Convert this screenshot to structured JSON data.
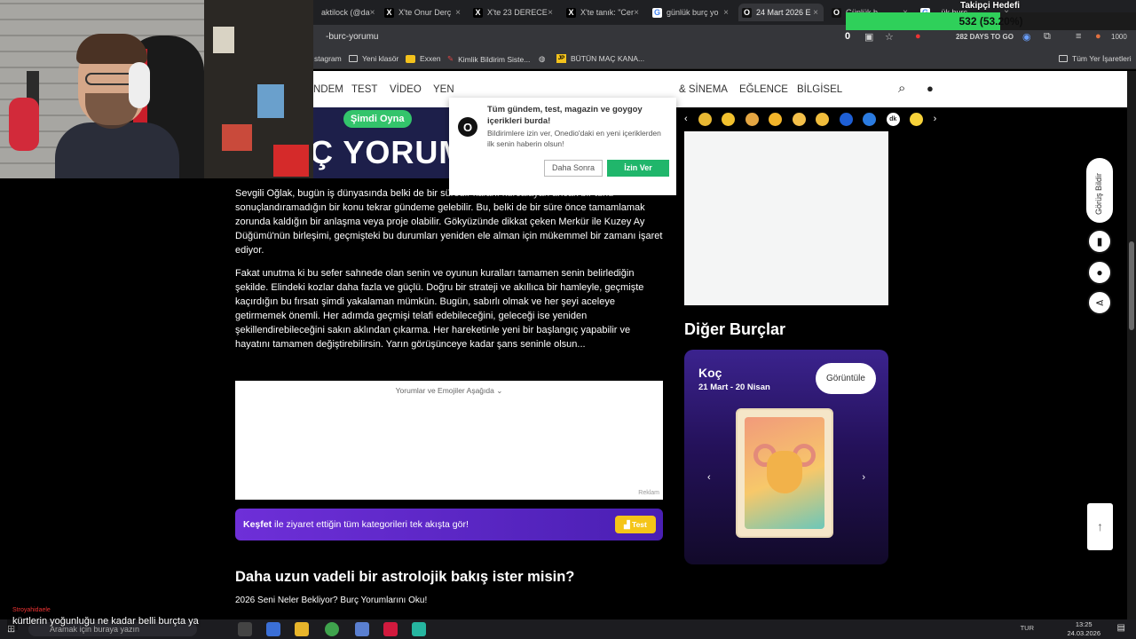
{
  "stream": {
    "follower_goal_title": "Takipçi Hedefi",
    "follower_goal_text": "532 (53.20%)",
    "follower_goal_fraction": 0.532,
    "goal_color": "#2fd05a"
  },
  "browser": {
    "tabs": [
      {
        "title": "aktilock (@da",
        "icon": "bird-icon"
      },
      {
        "title": "X'te Onur Derç",
        "icon": "x-logo-icon"
      },
      {
        "title": "X'te 23 DERECE",
        "icon": "x-logo-icon"
      },
      {
        "title": "X'te tanık: \"Cer",
        "icon": "x-logo-icon"
      },
      {
        "title": "günlük burç yo",
        "icon": "google-icon"
      },
      {
        "title": "24 Mart 2026 E",
        "icon": "onedio-icon"
      },
      {
        "title": "Günlük b",
        "icon": "onedio-icon"
      },
      {
        "title": "...ük burç",
        "icon": "google-icon"
      }
    ],
    "url": "-burc-yorumu",
    "zoom_badge": "0",
    "toolbar_text": "282 DAYS TO GO",
    "toolbar_count": "1000",
    "bookmarks": [
      {
        "label": "stagram",
        "icon": "instagram-icon"
      },
      {
        "label": "Yeni klasör",
        "icon": "folder-icon"
      },
      {
        "label": "Exxen",
        "icon": "exxen-icon"
      },
      {
        "label": "Kimlik Bildirim Siste...",
        "icon": "link-icon"
      },
      {
        "label": "",
        "icon": "globe-icon"
      },
      {
        "label": "BÜTÜN MAÇ KANA...",
        "icon": "jp-icon"
      }
    ],
    "all_bookmarks_label": "Tüm Yer İşaretleri"
  },
  "site": {
    "nav_items": [
      "NDEM",
      "TEST",
      "VİDEO",
      "YEN",
      "& SİNEMA",
      "EĞLENCE",
      "BİLGİSEL"
    ],
    "hero_button": "Şimdi Oyna",
    "hero_text": "Ç YORUMU",
    "emoji_reactions": [
      {
        "icon": "trophy-icon",
        "color": "#e8b833"
      },
      {
        "icon": "infinity-icon",
        "color": "#f2c12e"
      },
      {
        "icon": "neutral-face-icon",
        "color": "#e5a642"
      },
      {
        "icon": "heart-eyes-icon",
        "color": "#f3b52a"
      },
      {
        "icon": "crying-face-icon",
        "color": "#f4c04a"
      },
      {
        "icon": "smile-icon",
        "color": "#f1bd3c"
      },
      {
        "icon": "blue-badge-icon",
        "color": "#1e5fd6"
      },
      {
        "icon": "blue-badge-2-icon",
        "color": "#2b7be0"
      },
      {
        "icon": "dk-badge-icon",
        "color": "#ffffff",
        "text": "dk"
      },
      {
        "icon": "yellow-badge-icon",
        "color": "#f7d23a"
      }
    ]
  },
  "popup": {
    "title": "Tüm gündem, test, magazin ve goygoy içerikleri burda!",
    "body": "Bildirimlere izin ver, Onedio'daki en yeni içeriklerden ilk senin haberin olsun!",
    "later": "Daha Sonra",
    "allow": "İzin Ver",
    "logo": "O"
  },
  "article": {
    "p1": "Sevgili Oğlak, bugün iş dünyasında belki de bir süredir kafanı kurcalayan ancak bir türlü sonuçlandıramadığın bir konu tekrar gündeme gelebilir. Bu, belki de bir süre önce tamamlamak zorunda kaldığın bir anlaşma veya proje olabilir. Gökyüzünde dikkat çeken Merkür ile Kuzey Ay Düğümü'nün birleşimi, geçmişteki bu durumları yeniden ele alman için mükemmel bir zamanı işaret ediyor.",
    "p2": "Fakat unutma ki bu sefer sahnede olan senin ve oyunun kuralları tamamen senin belirlediğin şekilde. Elindeki kozlar daha fazla ve güçlü. Doğru bir strateji ve akıllıca bir hamleyle, geçmişte kaçırdığın bu fırsatı şimdi yakalaman mümkün. Bugün, sabırlı olmak ve her şeyi aceleye getirmemek önemli. Her adımda geçmişi telafi edebileceğini, geleceği ise yeniden şekillendirebileceğini sakın aklından çıkarma. Her hareketinle yeni bir başlangıç yapabilir ve hayatını tamamen değiştirebilirsin. Yarın görüşünceye kadar şans seninle olsun...",
    "comments_header": "Yorumlar ve Emojiler Aşağıda",
    "ad_label": "Reklam",
    "kesfet_bold": "Keşfet",
    "kesfet_rest": " ile ziyaret ettiğin tüm kategorileri tek akışta gör!",
    "kesfet_button": "Test",
    "h2": "Daha uzun vadeli bir astrolojik bakış ister misin?",
    "h3": "2026 Seni Neler Bekliyor? Burç Yorumlarını Oku!"
  },
  "sidebar": {
    "title": "Diğer Burçlar",
    "card_name": "Koç",
    "card_date": "21 Mart - 20 Nisan",
    "card_button": "Görüntüle",
    "prev": "‹",
    "next": "›"
  },
  "side_buttons": {
    "feedback": "Görüş Bildir"
  },
  "taskbar": {
    "search_placeholder": "Aramak için buraya yazın",
    "lang": "TUR",
    "time": "13:25",
    "date": "24.03.2026"
  },
  "subtitle": {
    "small": "Stroyahidaele",
    "big": "kürtlerin yoğunluğu ne kadar belli burçta ya"
  }
}
